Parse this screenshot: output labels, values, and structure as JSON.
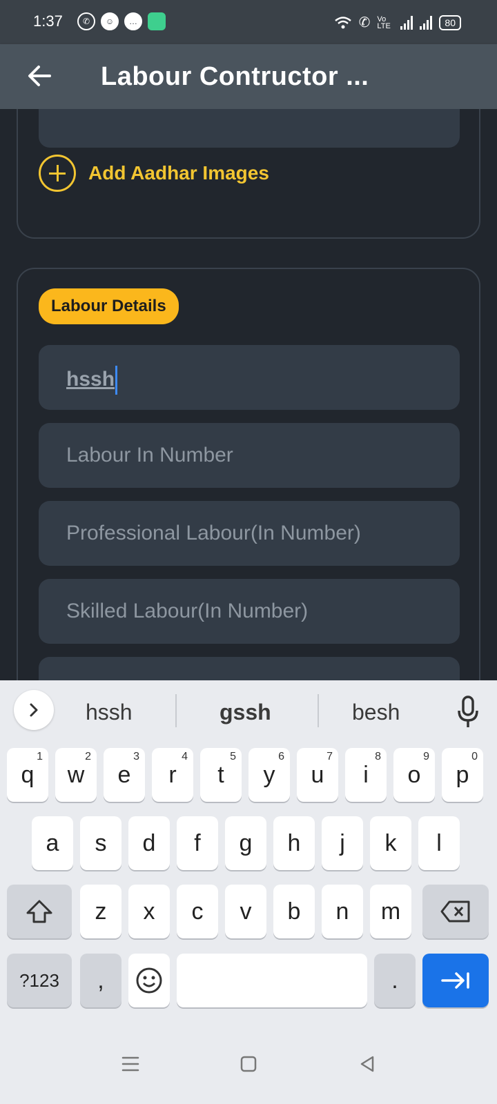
{
  "status": {
    "time": "1:37",
    "battery": "80",
    "network": "Vo LTE"
  },
  "appbar": {
    "title": "Labour Contructor ..."
  },
  "form": {
    "add_aadhar_label": "Add Aadhar Images",
    "section_badge": "Labour Details",
    "fields": {
      "name_value": "hssh",
      "labour_in_number": "Labour In Number",
      "professional_labour": "Professional Labour(In Number)",
      "skilled_labour": "Skilled Labour(In Number)"
    }
  },
  "keyboard": {
    "suggestions": [
      "hssh",
      "gssh",
      "besh"
    ],
    "row1": [
      {
        "k": "q",
        "n": "1"
      },
      {
        "k": "w",
        "n": "2"
      },
      {
        "k": "e",
        "n": "3"
      },
      {
        "k": "r",
        "n": "4"
      },
      {
        "k": "t",
        "n": "5"
      },
      {
        "k": "y",
        "n": "6"
      },
      {
        "k": "u",
        "n": "7"
      },
      {
        "k": "i",
        "n": "8"
      },
      {
        "k": "o",
        "n": "9"
      },
      {
        "k": "p",
        "n": "0"
      }
    ],
    "row2": [
      "a",
      "s",
      "d",
      "f",
      "g",
      "h",
      "j",
      "k",
      "l"
    ],
    "row3": [
      "z",
      "x",
      "c",
      "v",
      "b",
      "n",
      "m"
    ],
    "symbols_label": "?123",
    "comma": ",",
    "period": ".",
    "colors": {
      "enter": "#1a73e8",
      "accent": "#f2c531",
      "badge": "#fbb71c"
    }
  }
}
